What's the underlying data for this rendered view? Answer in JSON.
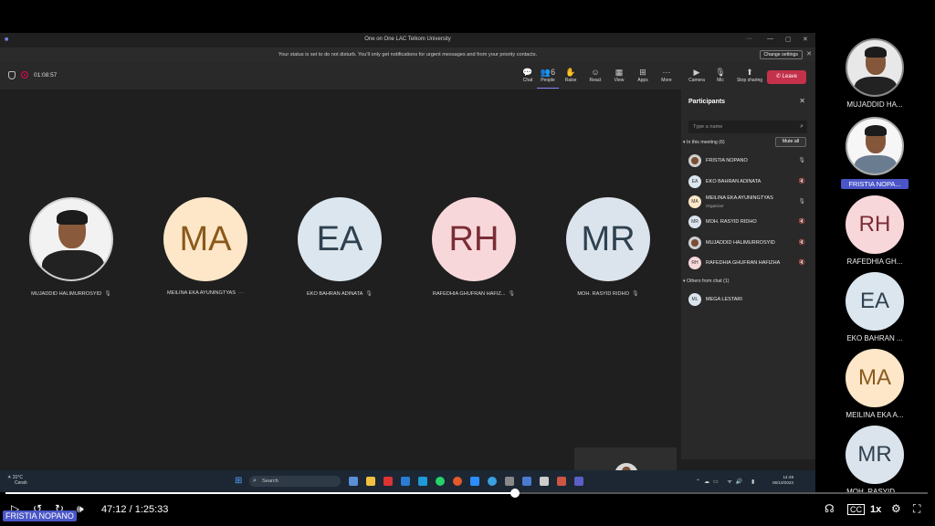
{
  "window": {
    "title": "One on One LAC Telkom University",
    "controls": [
      "···",
      "—",
      "▢",
      "✕"
    ]
  },
  "notice": {
    "message": "Your status is set to do not disturb. You'll only get notifications for urgent messages and from your priority contacts.",
    "button": "Change settings"
  },
  "meeting": {
    "timer": "01:08:57",
    "toolbar": [
      {
        "label": "Chat",
        "icon": "chat-icon",
        "glyph": "💬"
      },
      {
        "label": "People",
        "icon": "people-icon",
        "glyph": "👥",
        "badge": "6"
      },
      {
        "label": "Raise",
        "icon": "raise-hand-icon",
        "glyph": "✋"
      },
      {
        "label": "React",
        "icon": "react-icon",
        "glyph": "☺"
      },
      {
        "label": "View",
        "icon": "view-icon",
        "glyph": "▦"
      },
      {
        "label": "Apps",
        "icon": "apps-icon",
        "glyph": "⊞"
      },
      {
        "label": "More",
        "icon": "more-icon",
        "glyph": "···"
      },
      {
        "label": "Camera",
        "icon": "camera-icon",
        "glyph": "▶"
      },
      {
        "label": "Mic",
        "icon": "mic-icon",
        "glyph": "🎙"
      },
      {
        "label": "Stop sharing",
        "icon": "share-icon",
        "glyph": "⬆"
      }
    ],
    "leave": "Leave"
  },
  "stage": {
    "tiles": [
      {
        "name": "MUJADDID HALIMURROSYID",
        "initials": "",
        "photo": true,
        "suffix": "🎙"
      },
      {
        "name": "MEILINA EKA AYUNINGTYAS",
        "initials": "MA",
        "bg": "#fde7c8",
        "fg": "#8a5a1c",
        "suffix": "···"
      },
      {
        "name": "EKO BAHRAN ADINATA",
        "initials": "EA",
        "bg": "#dbe6ee",
        "fg": "#2f4150",
        "suffix": "🎙"
      },
      {
        "name": "RAFEDHIA GHUFRAN HAFIZ...",
        "initials": "RH",
        "bg": "#f8d7da",
        "fg": "#7a2d35",
        "suffix": "🎙"
      },
      {
        "name": "MOH. RASYID RIDHO",
        "initials": "MR",
        "bg": "#dbe4ec",
        "fg": "#2f4150",
        "suffix": "🎙"
      }
    ]
  },
  "participants": {
    "title": "Participants",
    "search_placeholder": "Type a name",
    "in_meeting": "In this meeting (6)",
    "mute_all": "Mute all",
    "others": "Others from chat (1)",
    "list": [
      {
        "name": "FRISTIA NOPANO",
        "initials": "",
        "bg": "#cfcfcf",
        "photo": true,
        "mic": "🎙"
      },
      {
        "name": "EKO BAHRAN ADINATA",
        "initials": "EA",
        "bg": "#dbe6ee",
        "mic": "🔇"
      },
      {
        "name": "MEILINA EKA AYUNINGTYAS",
        "initials": "MA",
        "bg": "#fde7c8",
        "sub": "Organizer",
        "mic": "🎙"
      },
      {
        "name": "MOH. RASYID RIDHO",
        "initials": "MR",
        "bg": "#dbe4ec",
        "mic": "🔇"
      },
      {
        "name": "MUJADDID HALIMURROSYID",
        "initials": "",
        "bg": "#cfcfcf",
        "photo": true,
        "mic": "🔇"
      },
      {
        "name": "RAFEDHIA GHUFRAN HAFIZHA",
        "initials": "RH",
        "bg": "#f8d7da",
        "mic": "🔇"
      }
    ],
    "others_list": [
      {
        "name": "MEGA LESTARI",
        "initials": "ML",
        "bg": "#dbe4ec"
      }
    ]
  },
  "taskbar": {
    "weather_temp": "31°C",
    "weather_desc": "Cerah",
    "search": "Search",
    "time": "14:49",
    "date": "06/10/2023"
  },
  "gallery": [
    {
      "name": "MUJADDID HA...",
      "initials": "",
      "photo": true
    },
    {
      "name": "FRISTIA NOPA...",
      "initials": "",
      "photo": true,
      "light": true,
      "highlight": true
    },
    {
      "name": "RAFEDHIA GH...",
      "initials": "RH",
      "bg": "#f8d7da",
      "fg": "#7a2d35"
    },
    {
      "name": "EKO BAHRAN ...",
      "initials": "EA",
      "bg": "#dbe6ee",
      "fg": "#2f4150"
    },
    {
      "name": "MEILINA EKA A...",
      "initials": "MA",
      "bg": "#fde7c8",
      "fg": "#8a5a1c"
    },
    {
      "name": "MOH. RASYID ...",
      "initials": "MR",
      "bg": "#dbe4ec",
      "fg": "#2f4150"
    }
  ],
  "player": {
    "time": "47:12 / 1:25:33",
    "progress": 0.552,
    "speed": "1x",
    "caption_name": "FRISTIA NOPANO",
    "skip_back": "10",
    "skip_forward": "10"
  }
}
